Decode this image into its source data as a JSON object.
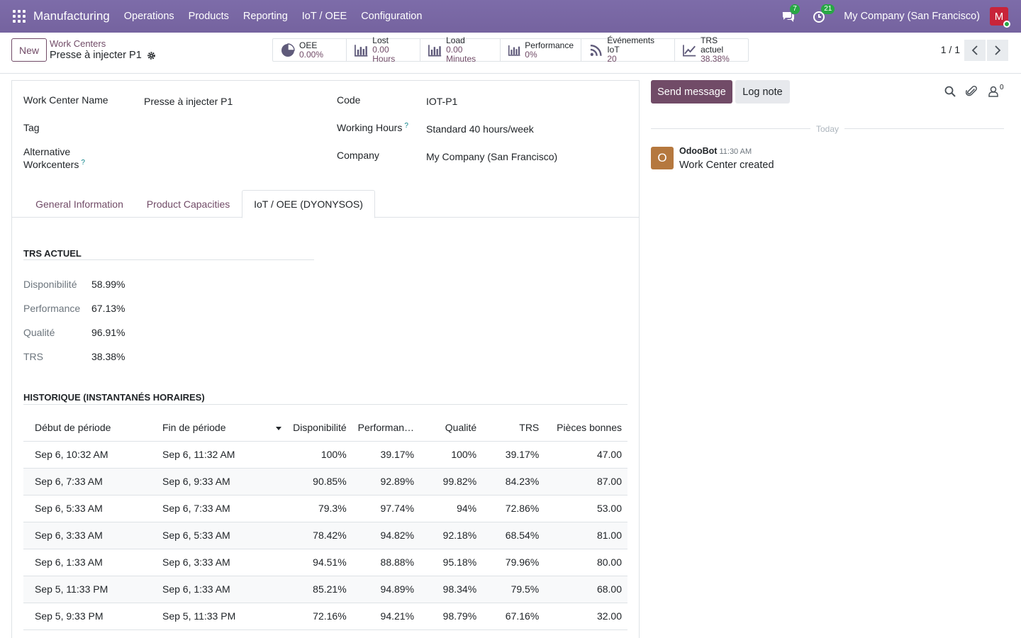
{
  "topbar": {
    "app_name": "Manufacturing",
    "menu": [
      "Operations",
      "Products",
      "Reporting",
      "IoT / OEE",
      "Configuration"
    ],
    "messages_count": "7",
    "activities_count": "21",
    "company": "My Company (San Francisco)",
    "avatar_letter": "M"
  },
  "control": {
    "new_label": "New",
    "breadcrumb_parent": "Work Centers",
    "breadcrumb_current": "Presse à injecter P1",
    "pager": "1 / 1",
    "smart_buttons": [
      {
        "label": "OEE",
        "value": "0.00%",
        "icon": "pie-chart-icon"
      },
      {
        "label": "Lost",
        "value": "0.00 Hours",
        "icon": "bar-chart-icon"
      },
      {
        "label": "Load",
        "value": "0.00 Minutes",
        "icon": "bar-chart-icon"
      },
      {
        "label": "Performance",
        "value": "0%",
        "icon": "bar-chart-icon"
      },
      {
        "label": "Événements IoT",
        "value": "20",
        "icon": "rss-icon"
      },
      {
        "label": "TRS actuel",
        "value": "38.38%",
        "icon": "line-chart-icon"
      }
    ]
  },
  "form": {
    "work_center_name_label": "Work Center Name",
    "work_center_name": "Presse à injecter P1",
    "tag_label": "Tag",
    "alt_label_1": "Alternative",
    "alt_label_2": "Workcenters",
    "code_label": "Code",
    "code": "IOT-P1",
    "working_hours_label": "Working Hours",
    "working_hours": "Standard 40 hours/week",
    "company_label": "Company",
    "company": "My Company (San Francisco)",
    "help_mark": "?"
  },
  "tabs": [
    "General Information",
    "Product Capacities",
    "IoT / OEE (DYONYSOS)"
  ],
  "trs": {
    "title": "TRS ACTUEL",
    "rows": [
      {
        "label": "Disponibilité",
        "value": "58.99%"
      },
      {
        "label": "Performance",
        "value": "67.13%"
      },
      {
        "label": "Qualité",
        "value": "96.91%"
      },
      {
        "label": "TRS",
        "value": "38.38%"
      }
    ]
  },
  "history": {
    "title": "HISTORIQUE (INSTANTANÉS HORAIRES)",
    "columns": [
      "Début de période",
      "Fin de période",
      "Disponibilité",
      "Performan…",
      "Qualité",
      "TRS",
      "Pièces bonnes"
    ],
    "rows": [
      [
        "Sep 6, 10:32 AM",
        "Sep 6, 11:32 AM",
        "100%",
        "39.17%",
        "100%",
        "39.17%",
        "47.00"
      ],
      [
        "Sep 6, 7:33 AM",
        "Sep 6, 9:33 AM",
        "90.85%",
        "92.89%",
        "99.82%",
        "84.23%",
        "87.00"
      ],
      [
        "Sep 6, 5:33 AM",
        "Sep 6, 7:33 AM",
        "79.3%",
        "97.74%",
        "94%",
        "72.86%",
        "53.00"
      ],
      [
        "Sep 6, 3:33 AM",
        "Sep 6, 5:33 AM",
        "78.42%",
        "94.82%",
        "92.18%",
        "68.54%",
        "81.00"
      ],
      [
        "Sep 6, 1:33 AM",
        "Sep 6, 3:33 AM",
        "94.51%",
        "88.88%",
        "95.18%",
        "79.96%",
        "80.00"
      ],
      [
        "Sep 5, 11:33 PM",
        "Sep 6, 1:33 AM",
        "85.21%",
        "94.89%",
        "98.34%",
        "79.5%",
        "68.00"
      ],
      [
        "Sep 5, 9:33 PM",
        "Sep 5, 11:33 PM",
        "72.16%",
        "94.21%",
        "98.79%",
        "67.16%",
        "32.00"
      ]
    ]
  },
  "chatter": {
    "send_label": "Send message",
    "log_label": "Log note",
    "followers_count": "0",
    "today_label": "Today",
    "message": {
      "avatar_letter": "O",
      "author": "OdooBot",
      "time": "11:30 AM",
      "body": "Work Center created"
    }
  },
  "colors": {
    "navbar": "#7c6aa6",
    "primary": "#714b67",
    "success_badge": "#28a745"
  }
}
